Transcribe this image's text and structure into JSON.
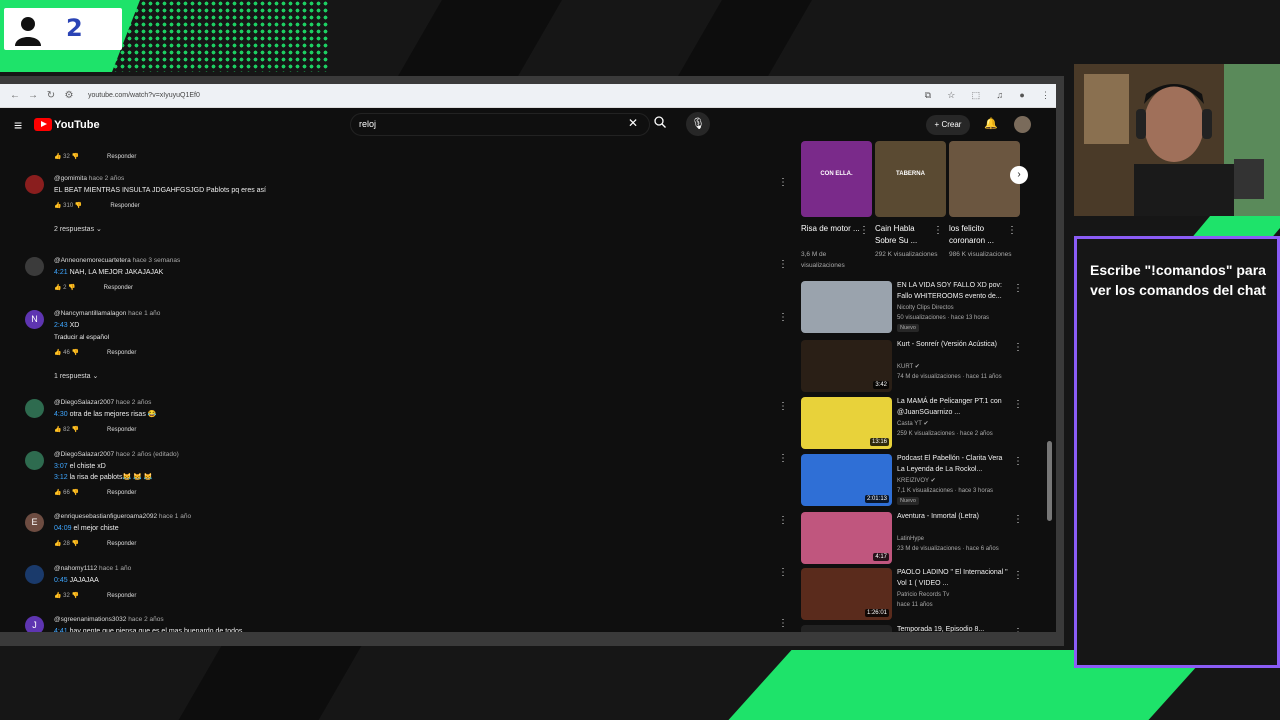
{
  "overlay": {
    "viewer_count": "2",
    "chat_commands_text": "Escribe \"!comandos\" para ver los comandos del chat"
  },
  "browser": {
    "url": "youtube.com/watch?v=xIyuyuQ1Ef0"
  },
  "youtube": {
    "logo_text": "YouTube",
    "search_value": "reloj",
    "create_label": "Crear"
  },
  "comments": [
    {
      "avatar_letter": "",
      "avatar_color": "#8a1e1e",
      "user": "@gomimita",
      "when": "hace 2 años",
      "text": "EL BEAT MIENTRAS INSULTA JDGAHFGSJGD Pablots pq eres así",
      "timestamp": "",
      "likes": "310",
      "reply": "Responder",
      "replies": "2 respuestas"
    },
    {
      "avatar_letter": "",
      "avatar_color": "#3b3b3b",
      "user": "@Anneonemorecuartetera",
      "when": "hace 3 semanas",
      "text": "NAH, LA MEJOR JAKAJAJAK",
      "timestamp": "4:21",
      "likes": "2",
      "reply": "Responder",
      "replies": ""
    },
    {
      "avatar_letter": "N",
      "avatar_color": "#5e35b1",
      "user": "@Nancymantillamalagon",
      "when": "hace 1 año",
      "text": "XD",
      "timestamp": "2:43",
      "extra": "Traducir al español",
      "likes": "46",
      "reply": "Responder",
      "replies": "1 respuesta"
    },
    {
      "avatar_letter": "",
      "avatar_color": "#2e6b4f",
      "user": "@DiegoSalazar2007",
      "when": "hace 2 años",
      "text": "otra de las mejores risas 😂",
      "timestamp": "4:30",
      "likes": "82",
      "reply": "Responder",
      "replies": ""
    },
    {
      "avatar_letter": "",
      "avatar_color": "#2e6b4f",
      "user": "@DiegoSalazar2007",
      "when": "hace 2 años (editado)",
      "text": "el chiste xD",
      "timestamp": "3:07",
      "text2": "la risa de pablots😹 😹 😹",
      "timestamp2": "3:12",
      "likes": "66",
      "reply": "Responder",
      "replies": ""
    },
    {
      "avatar_letter": "E",
      "avatar_color": "#6d4c41",
      "user": "@enriquesebastianfigueroama2092",
      "when": "hace 1 año",
      "text": "el mejor chiste",
      "timestamp": "04:09",
      "likes": "28",
      "reply": "Responder",
      "replies": ""
    },
    {
      "avatar_letter": "",
      "avatar_color": "#1a3a6b",
      "user": "@nahomy1112",
      "when": "hace 1 año",
      "text": "JAJAJAA",
      "timestamp": "0:45",
      "likes": "32",
      "reply": "Responder",
      "replies": ""
    },
    {
      "avatar_letter": "J",
      "avatar_color": "#5e35b1",
      "user": "@sgreenanimations3032",
      "when": "hace 2 años",
      "text": "hay gente que piensa que es el mas buenardo de todos",
      "timestamp": "4:41",
      "likes": "",
      "reply": "",
      "replies": ""
    }
  ],
  "top_comment": {
    "likes": "32",
    "reply": "Responder"
  },
  "shorts": [
    {
      "title": "Risa de motor ...",
      "views": "3,6 M de visualizaciones",
      "color": "#7a2a8a",
      "caption": "CON ELLA."
    },
    {
      "title": "Cain Habla Sobre Su ...",
      "views": "292 K visualizaciones",
      "color": "#5a4a32",
      "caption": "TABERNA"
    },
    {
      "title": "los felicito coronaron ...",
      "views": "986 K visualizaciones",
      "color": "#6b5640",
      "caption": ""
    }
  ],
  "videos": [
    {
      "title": "EN LA VIDA SOY FALLO XD pov: Fallo WHITEROOMS evento de...",
      "channel": "Nicolty Clips Directos",
      "meta": "50 visualizaciones · hace 13 horas",
      "badge": "Nuevo",
      "duration": "",
      "color": "#9aa3ad"
    },
    {
      "title": "Kurt - Sonreír (Versión Acústica)",
      "channel": "KURT ✔",
      "meta": "74 M de visualizaciones · hace 11 años",
      "badge": "",
      "duration": "3:42",
      "color": "#2a1f16"
    },
    {
      "title": "La MAMÁ de Pelicanger PT.1 con @JuanSGuarnizo ...",
      "channel": "Casta YT ✔",
      "meta": "259 K visualizaciones · hace 2 años",
      "badge": "",
      "duration": "13:16",
      "color": "#e8d23a"
    },
    {
      "title": "Podcast El Pabellón - Clarita Vera La Leyenda de La Rockol...",
      "channel": "KREIZIVOY ✔",
      "meta": "7,1 K visualizaciones · hace 3 horas",
      "badge": "Nuevo",
      "duration": "2:01:13",
      "color": "#2f6fd6"
    },
    {
      "title": "Aventura - Inmortal (Letra)",
      "channel": "LatinHype",
      "meta": "23 M de visualizaciones · hace 6 años",
      "badge": "",
      "duration": "4:17",
      "color": "#c0567e"
    },
    {
      "title": "PAOLO LADINO \" El Internacional \" Vol 1 ( VIDEO ...",
      "channel": "Patricio Records Tv",
      "meta": "hace 11 años",
      "badge": "",
      "duration": "1:26:01",
      "color": "#5a2b1c"
    },
    {
      "title": "Temporada 19, Episodio 8...",
      "channel": "",
      "meta": "",
      "badge": "",
      "duration": "",
      "color": "#222"
    }
  ]
}
